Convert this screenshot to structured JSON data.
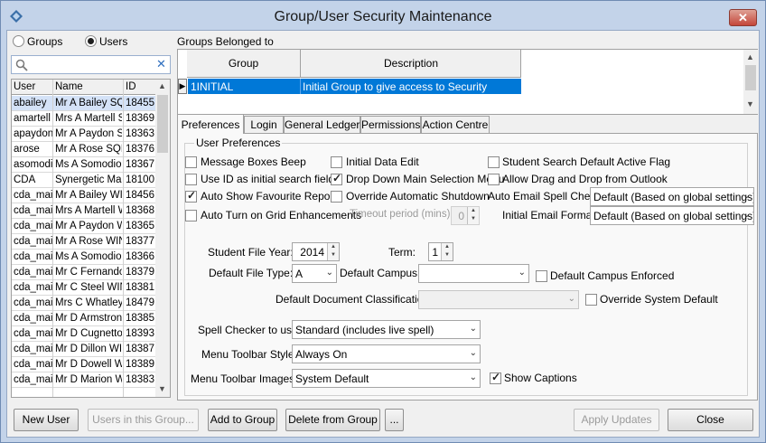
{
  "window": {
    "title": "Group/User Security Maintenance",
    "close_label": "✕"
  },
  "mode": {
    "groups_label": "Groups",
    "users_label": "Users",
    "selected": "Users"
  },
  "search": {
    "placeholder": "",
    "value": ""
  },
  "users_grid": {
    "columns": [
      "User",
      "Name",
      "ID"
    ],
    "rows": [
      [
        "abailey",
        "Mr A Bailey SQL",
        "18455"
      ],
      [
        "amartell",
        "Mrs A Martell SC",
        "18369"
      ],
      [
        "apaydon",
        "Mr A Paydon SC",
        "18363"
      ],
      [
        "arose",
        "Mr A Rose SQL",
        "18376"
      ],
      [
        "asomodio",
        "Ms A Somodio S",
        "18367"
      ],
      [
        "CDA",
        "Synergetic Man",
        "18100"
      ],
      [
        "cda_main",
        "Mr A Bailey WIN",
        "18456"
      ],
      [
        "cda_main",
        "Mrs A Martell W",
        "18368"
      ],
      [
        "cda_main",
        "Mr A Paydon W",
        "18365"
      ],
      [
        "cda_main",
        "Mr A Rose WIN",
        "18377"
      ],
      [
        "cda_main",
        "Ms A Somodio W",
        "18366"
      ],
      [
        "cda_main",
        "Mr C Fernando",
        "18379"
      ],
      [
        "cda_main",
        "Mr C Steel WIN",
        "18381"
      ],
      [
        "cda_main",
        "Mrs C Whatley",
        "18479"
      ],
      [
        "cda_main",
        "Mr D Armstrong",
        "18385"
      ],
      [
        "cda_main",
        "Mr D Cugnetto",
        "18393"
      ],
      [
        "cda_main",
        "Mr D Dillon WIN",
        "18387"
      ],
      [
        "cda_main",
        "Mr D Dowell WI",
        "18389"
      ],
      [
        "cda_main",
        "Mr D Marion WI",
        "18383"
      ]
    ]
  },
  "groups_belonged": {
    "label": "Groups Belonged to",
    "columns": [
      "Group",
      "Description"
    ],
    "rows": [
      [
        "1INITIAL",
        "Initial Group to give access to Security"
      ]
    ]
  },
  "tabs": [
    "Preferences",
    "Login",
    "General Ledger",
    "Permissions",
    "Action Centre"
  ],
  "active_tab": "Preferences",
  "preferences": {
    "group_title": "User Preferences",
    "checkboxes": {
      "message_boxes_beep": {
        "label": "Message Boxes Beep",
        "checked": false
      },
      "initial_data_edit": {
        "label": "Initial Data Edit",
        "checked": false
      },
      "student_search_default_active": {
        "label": "Student Search Default Active Flag",
        "checked": false
      },
      "use_id_initial_search": {
        "label": "Use ID as initial search field",
        "checked": false
      },
      "drop_down_main_selection": {
        "label": "Drop Down Main Selection Menu",
        "checked": true
      },
      "allow_drag_drop_outlook": {
        "label": "Allow Drag and Drop from Outlook",
        "checked": false
      },
      "auto_show_favourite_reports": {
        "label": "Auto Show Favourite Reports",
        "checked": true
      },
      "override_auto_shutdown": {
        "label": "Override Automatic Shutdown",
        "checked": false
      },
      "auto_turn_on_grid": {
        "label": "Auto Turn on Grid Enhancements",
        "checked": false
      },
      "default_campus_enforced": {
        "label": "Default Campus Enforced",
        "checked": false
      },
      "override_system_default": {
        "label": "Override System Default",
        "checked": false
      },
      "show_captions": {
        "label": "Show Captions",
        "checked": true
      }
    },
    "timeout": {
      "label": "Timeout period (mins):",
      "value": "0"
    },
    "auto_email_spell_check": {
      "label": "Auto Email Spell Check:",
      "value": "Default (Based on global settings)"
    },
    "initial_email_format": {
      "label": "Initial Email Format:",
      "value": "Default (Based on global settings)"
    },
    "student_file_year": {
      "label": "Student File Year:",
      "value": "2014"
    },
    "term": {
      "label": "Term:",
      "value": "1"
    },
    "default_file_type": {
      "label": "Default File Type:",
      "value": "A"
    },
    "default_campus": {
      "label": "Default Campus:",
      "value": ""
    },
    "default_document_classification": {
      "label": "Default Document Classification:",
      "value": ""
    },
    "spell_checker": {
      "label": "Spell Checker to use:",
      "value": "Standard (includes live spell)"
    },
    "menu_toolbar_style": {
      "label": "Menu Toolbar Style:",
      "value": "Always On"
    },
    "menu_toolbar_images": {
      "label": "Menu Toolbar Images:",
      "value": "System Default"
    }
  },
  "buttons": {
    "new_user": "New User",
    "users_in_group": "Users in this Group...",
    "add_to_group": "Add to Group",
    "delete_from_group": "Delete from Group",
    "more": "...",
    "apply_updates": "Apply Updates",
    "close": "Close"
  },
  "colors": {
    "selection_row": "#0078d7",
    "title_bar": "#c3d3e9",
    "close_button": "#c4463a"
  }
}
